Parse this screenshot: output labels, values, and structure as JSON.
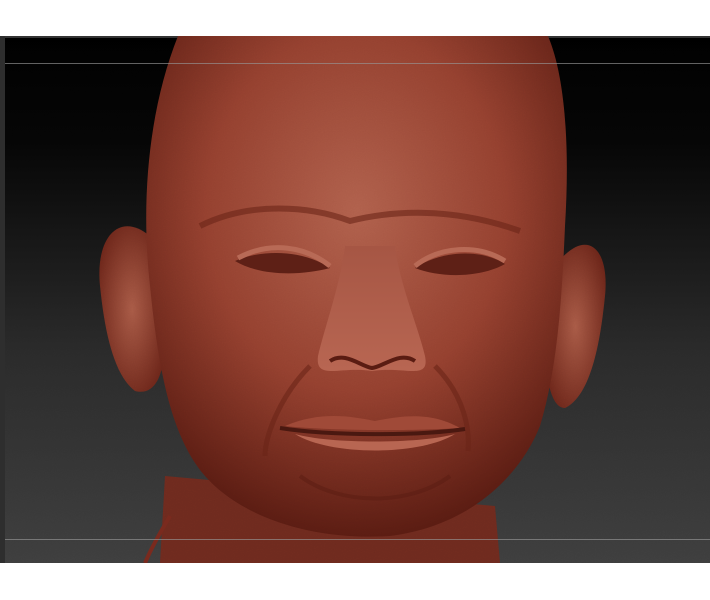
{
  "viewport": {
    "content": "sculpted-head-model",
    "colors": {
      "material": "#8a3a2c",
      "material_highlight": "#b5614d",
      "material_shadow": "#4a1810",
      "background_top": "#000000",
      "background_bottom": "#3e3e3e",
      "guide_line": "#8a8a8a"
    }
  }
}
